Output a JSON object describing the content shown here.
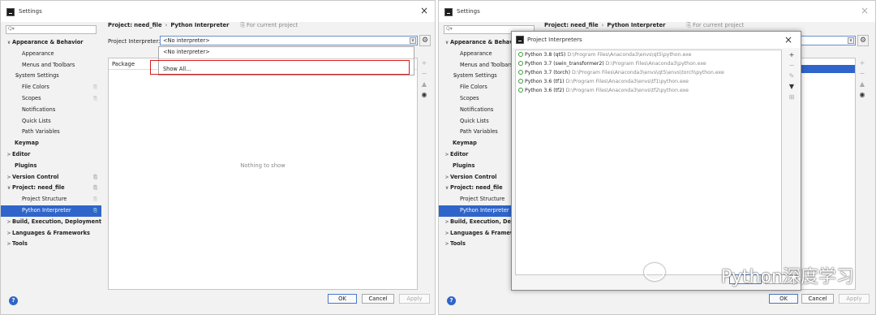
{
  "left_window": {
    "title": "Settings",
    "close": "×",
    "sidebar": [
      {
        "label": "Appearance & Behavior",
        "bold": true,
        "arrow": "∨",
        "indent": 0
      },
      {
        "label": "Appearance",
        "indent": 2
      },
      {
        "label": "Menus and Toolbars",
        "indent": 2
      },
      {
        "label": "System Settings",
        "arrow": ">",
        "indent": 1
      },
      {
        "label": "File Colors",
        "indent": 2,
        "cp": true
      },
      {
        "label": "Scopes",
        "indent": 2,
        "cp": true
      },
      {
        "label": "Notifications",
        "indent": 2
      },
      {
        "label": "Quick Lists",
        "indent": 2
      },
      {
        "label": "Path Variables",
        "indent": 2
      },
      {
        "label": "Keymap",
        "bold": true,
        "indent": 0.5
      },
      {
        "label": "Editor",
        "bold": true,
        "arrow": ">",
        "indent": 0
      },
      {
        "label": "Plugins",
        "bold": true,
        "indent": 0.5
      },
      {
        "label": "Version Control",
        "bold": true,
        "arrow": ">",
        "indent": 0,
        "cp": true
      },
      {
        "label": "Project: need_file",
        "bold": true,
        "arrow": "∨",
        "indent": 0,
        "cp": true
      },
      {
        "label": "Project Structure",
        "indent": 2,
        "cp": true
      },
      {
        "label": "Python Interpreter",
        "indent": 2,
        "cp": true,
        "selected": true
      },
      {
        "label": "Build, Execution, Deployment",
        "bold": true,
        "arrow": ">",
        "indent": 0
      },
      {
        "label": "Languages & Frameworks",
        "bold": true,
        "arrow": ">",
        "indent": 0
      },
      {
        "label": "Tools",
        "bold": true,
        "arrow": ">",
        "indent": 0
      }
    ],
    "breadcrumb": {
      "project": "Project: need_file",
      "sep": "›",
      "page": "Python Interpreter",
      "for_current": "⎘ For current project"
    },
    "interpreter_label": "Project Interpreter:",
    "interpreter_value": "<No interpreter>",
    "dropdown_options": [
      "<No interpreter>",
      "Show All..."
    ],
    "table_header": "Package",
    "empty_text": "Nothing to show",
    "buttons": {
      "ok": "OK",
      "cancel": "Cancel",
      "apply": "Apply"
    },
    "help": "?"
  },
  "right_window": {
    "title": "Settings",
    "close": "×",
    "sidebar": [
      {
        "label": "Appearance & Behavior",
        "bold": true,
        "arrow": "∨",
        "indent": 0
      },
      {
        "label": "Appearance",
        "indent": 2
      },
      {
        "label": "Menus and Toolbars",
        "indent": 2
      },
      {
        "label": "System Settings",
        "arrow": ">",
        "indent": 1
      },
      {
        "label": "File Colors",
        "indent": 2
      },
      {
        "label": "Scopes",
        "indent": 2
      },
      {
        "label": "Notifications",
        "indent": 2
      },
      {
        "label": "Quick Lists",
        "indent": 2
      },
      {
        "label": "Path Variables",
        "indent": 2
      },
      {
        "label": "Keymap",
        "bold": true,
        "indent": 0.5
      },
      {
        "label": "Editor",
        "bold": true,
        "arrow": ">",
        "indent": 0
      },
      {
        "label": "Plugins",
        "bold": true,
        "indent": 0.5
      },
      {
        "label": "Version Control",
        "bold": true,
        "arrow": ">",
        "indent": 0
      },
      {
        "label": "Project: need_file",
        "bold": true,
        "arrow": "∨",
        "indent": 0
      },
      {
        "label": "Project Structure",
        "indent": 2
      },
      {
        "label": "Python Interpreter",
        "indent": 2,
        "selected": true
      },
      {
        "label": "Build, Execution, Deployment",
        "bold": true,
        "arrow": ">",
        "indent": 0
      },
      {
        "label": "Languages & Frameworks",
        "bold": true,
        "arrow": ">",
        "indent": 0
      },
      {
        "label": "Tools",
        "bold": true,
        "arrow": ">",
        "indent": 0
      }
    ],
    "breadcrumb": {
      "project": "Project: need_file",
      "sep": "›",
      "page": "Python Interpreter",
      "for_current": "⎘ For current project"
    },
    "buttons": {
      "ok": "OK",
      "cancel": "Cancel",
      "apply": "Apply"
    },
    "help": "?",
    "dialog": {
      "title": "Project Interpreters",
      "close": "×",
      "interpreters": [
        {
          "name": "Python 3.8 (qt5)",
          "path": "D:\\Program Files\\Anaconda3\\envs\\qt5\\python.exe"
        },
        {
          "name": "Python 3.7 (swin_transformer2)",
          "path": "D:\\Program Files\\Anaconda3\\python.exe"
        },
        {
          "name": "Python 3.7 (torch)",
          "path": "D:\\Program Files\\Anaconda3\\envs\\qt5\\envs\\torch\\python.exe"
        },
        {
          "name": "Python 3.6 (tf1)",
          "path": "D:\\Program Files\\Anaconda3\\envs\\tf1\\python.exe"
        },
        {
          "name": "Python 3.6 (tf2)",
          "path": "D:\\Program Files\\Anaconda3\\envs\\tf2\\python.exe"
        }
      ]
    },
    "watermark": "Python深度学习"
  }
}
